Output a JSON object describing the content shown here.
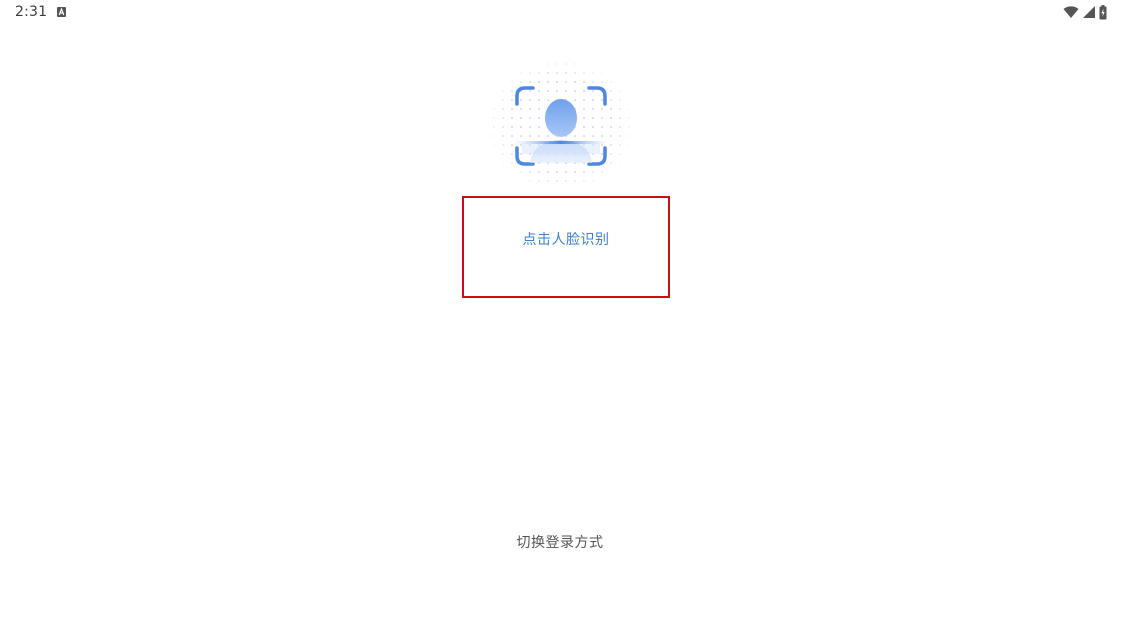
{
  "status_bar": {
    "time": "2:31",
    "notification_icon": "a-letter-badge-icon",
    "icons": [
      "wifi-icon",
      "cellular-signal-icon",
      "battery-charging-icon"
    ]
  },
  "face_login": {
    "illustration_icon": "face-scan-icon",
    "action_label": "点击人脸识别",
    "switch_label": "切换登录方式"
  },
  "colors": {
    "accent": "#3a7fd6",
    "scan_frame": "#4e86e0",
    "highlight_border": "#cc0f14",
    "secondary_text": "#555555"
  }
}
